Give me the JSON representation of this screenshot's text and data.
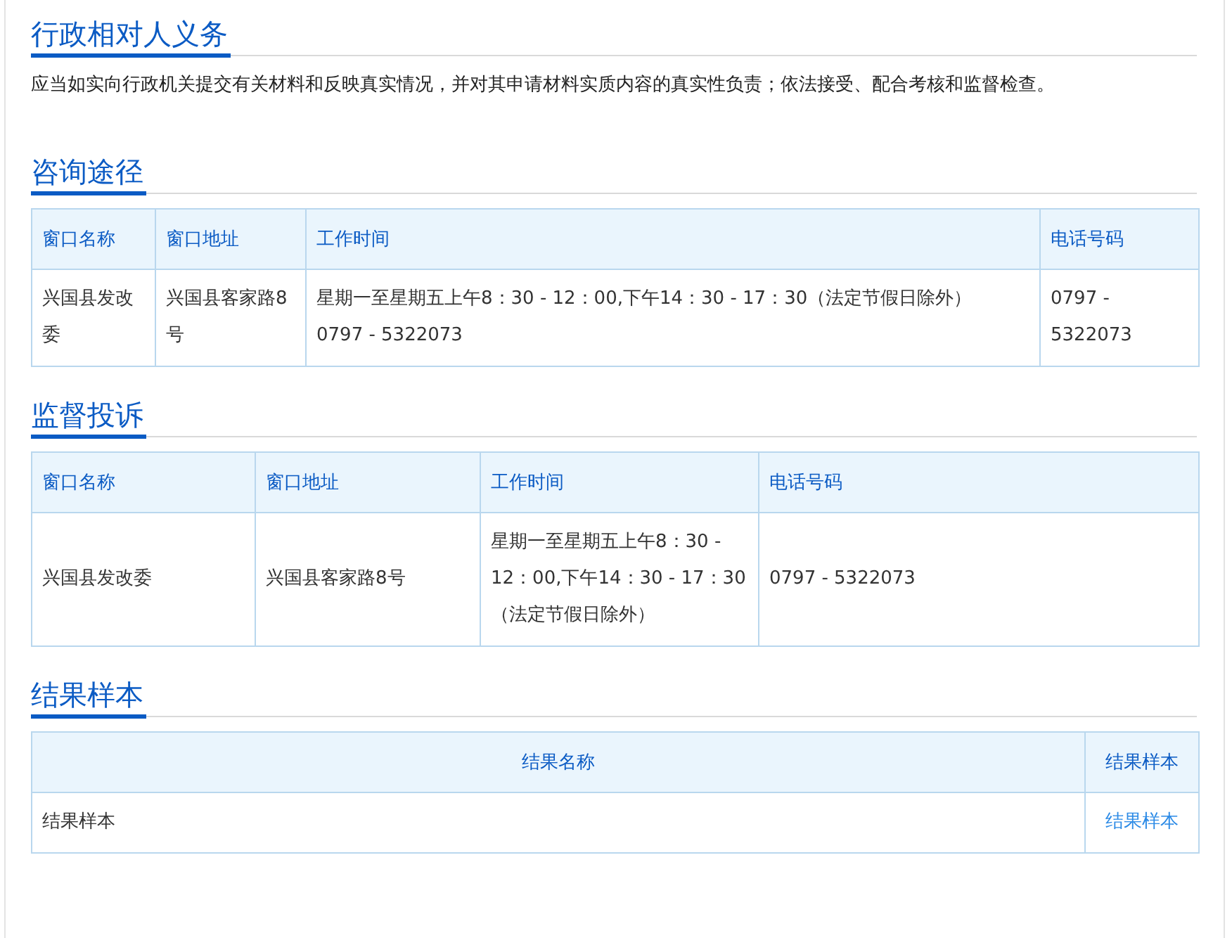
{
  "sections": [
    {
      "title": "行政相对人义务",
      "kind": "text",
      "text": "应当如实向行政机关提交有关材料和反映真实情况，并对其申请材料实质内容的真实性负责；依法接受、配合考核和监督检查。"
    },
    {
      "title": "咨询途径",
      "kind": "table",
      "columns": [
        "窗口名称",
        "窗口地址",
        "工作时间",
        "电话号码"
      ],
      "rows": [
        [
          {
            "kind": "text",
            "text": "兴国县发改委"
          },
          {
            "kind": "text",
            "text": "兴国县客家路8号"
          },
          {
            "kind": "text",
            "text": "星期一至星期五上午8：30 - 12：00,下午14：30 - 17：30（法定节假日除外）\n0797 - 5322073"
          },
          {
            "kind": "text",
            "text": "0797 - 5322073"
          }
        ]
      ]
    },
    {
      "title": "监督投诉",
      "kind": "table",
      "columns": [
        "窗口名称",
        "窗口地址",
        "工作时间",
        "电话号码"
      ],
      "rows": [
        [
          {
            "kind": "text",
            "text": "兴国县发改委"
          },
          {
            "kind": "text",
            "text": "兴国县客家路8号"
          },
          {
            "kind": "text",
            "text": "星期一至星期五上午8：30 - 12：00,下午14：30 - 17：30（法定节假日除外）"
          },
          {
            "kind": "text",
            "text": "0797 - 5322073"
          }
        ]
      ]
    },
    {
      "title": "结果样本",
      "kind": "table",
      "columns": [
        "结果名称",
        "结果样本"
      ],
      "rows": [
        [
          {
            "kind": "text",
            "text": "结果样本"
          },
          {
            "kind": "link",
            "text": "结果样本"
          }
        ]
      ]
    }
  ]
}
